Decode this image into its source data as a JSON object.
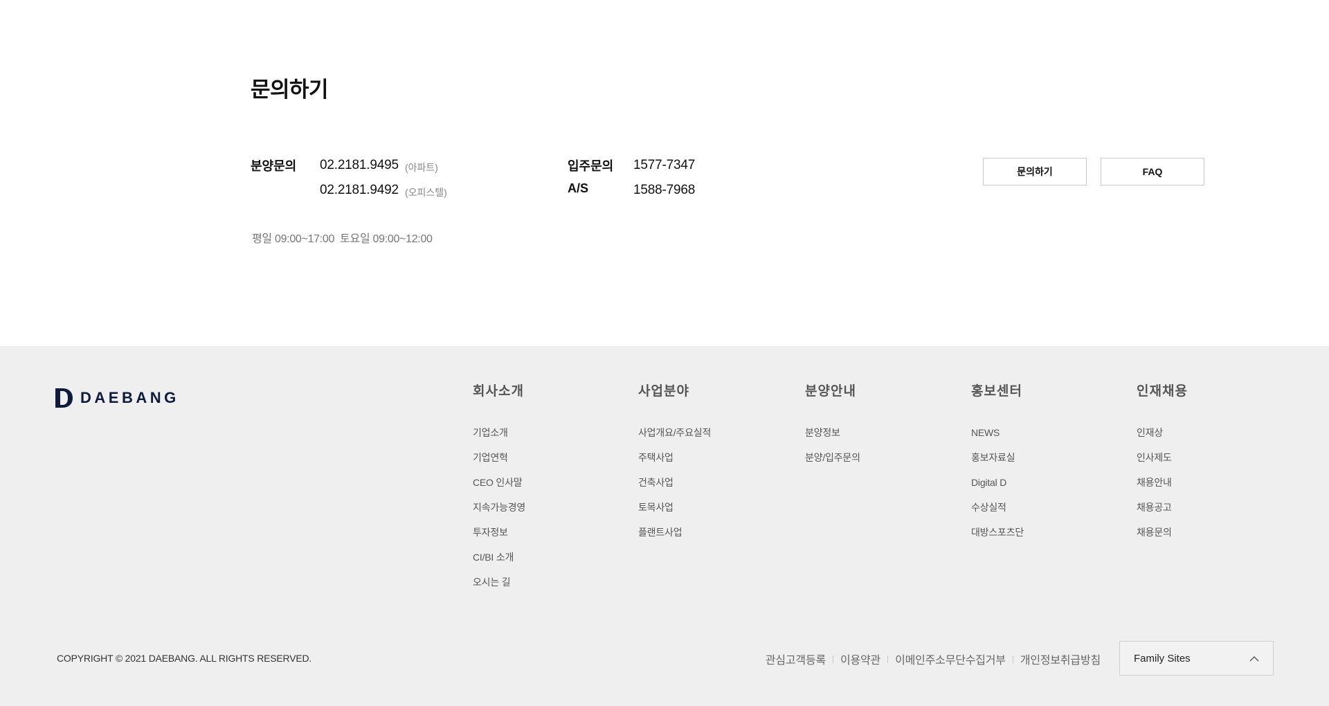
{
  "contact": {
    "title": "문의하기",
    "sales": {
      "label": "분양문의",
      "lines": [
        {
          "phone": "02.2181.9495",
          "note": "(아파트)"
        },
        {
          "phone": "02.2181.9492",
          "note": "(오피스텔)"
        }
      ]
    },
    "move_in": {
      "label": "입주문의",
      "phone": "1577-7347"
    },
    "as": {
      "label": "A/S",
      "phone": "1588-7968"
    },
    "hours": {
      "weekday": "평일 09:00~17:00",
      "saturday": "토요일 09:00~12:00"
    },
    "buttons": {
      "inquiry": "문의하기",
      "faq": "FAQ"
    }
  },
  "footer": {
    "logo_text": "DAEBANG",
    "menu": [
      {
        "heading": "회사소개",
        "items": [
          "기업소개",
          "기업연혁",
          "CEO 인사말",
          "지속가능경영",
          "투자정보",
          "CI/BI 소개",
          "오시는 길"
        ]
      },
      {
        "heading": "사업분야",
        "items": [
          "사업개요/주요실적",
          "주택사업",
          "건축사업",
          "토목사업",
          "플랜트사업"
        ]
      },
      {
        "heading": "분양안내",
        "items": [
          "분양정보",
          "분양/입주문의"
        ]
      },
      {
        "heading": "홍보센터",
        "items": [
          "NEWS",
          "홍보자료실",
          "Digital D",
          "수상실적",
          "대방스포츠단"
        ]
      },
      {
        "heading": "인재채용",
        "items": [
          "인재상",
          "인사제도",
          "채용안내",
          "채용공고",
          "채용문의"
        ]
      }
    ],
    "copyright": "COPYRIGHT © 2021 DAEBANG. ALL RIGHTS RESERVED.",
    "policy_links": [
      "관심고객등록",
      "이용약관",
      "이메인주소무단수집거부",
      "개인정보취급방침"
    ],
    "family_sites": {
      "label": "Family Sites",
      "icon": "chevron-up-icon"
    }
  },
  "colors": {
    "footer_bg": "#efefef",
    "brand_navy": "#0e1b3c",
    "border": "#c8c8c8"
  }
}
